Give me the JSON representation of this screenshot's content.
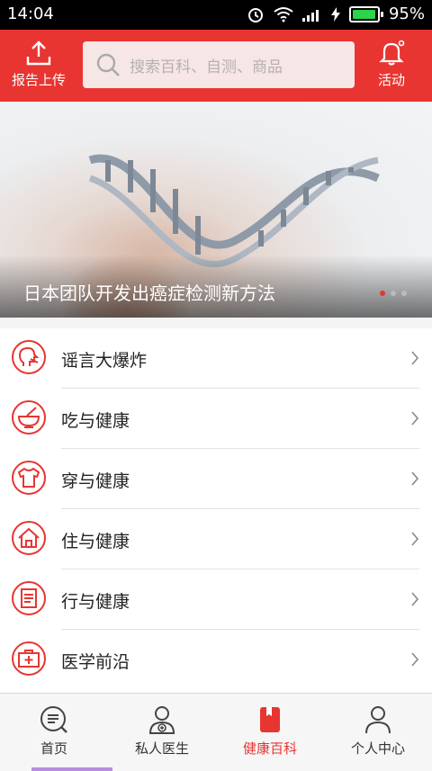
{
  "status_bar": {
    "time": "14:04",
    "battery": "95%",
    "battery_level": 0.95
  },
  "header": {
    "upload_label": "报告上传",
    "search_placeholder": "搜索百科、自测、商品",
    "activity_label": "活动",
    "brand_color": "#e83531"
  },
  "banner": {
    "caption": "日本团队开发出癌症检测新方法",
    "pages": 3,
    "active_page": 1
  },
  "menu": {
    "items": [
      {
        "label": "谣言大爆炸",
        "icon": "rumor-icon"
      },
      {
        "label": "吃与健康",
        "icon": "bowl-icon"
      },
      {
        "label": "穿与健康",
        "icon": "shirt-icon"
      },
      {
        "label": "住与健康",
        "icon": "house-icon"
      },
      {
        "label": "行与健康",
        "icon": "document-icon"
      },
      {
        "label": "医学前沿",
        "icon": "medical-kit-icon"
      }
    ]
  },
  "tabs": [
    {
      "label": "首页",
      "icon": "search-list-icon",
      "active": false
    },
    {
      "label": "私人医生",
      "icon": "doctor-icon",
      "active": false
    },
    {
      "label": "健康百科",
      "icon": "book-icon",
      "active": true
    },
    {
      "label": "个人中心",
      "icon": "person-icon",
      "active": false
    }
  ]
}
